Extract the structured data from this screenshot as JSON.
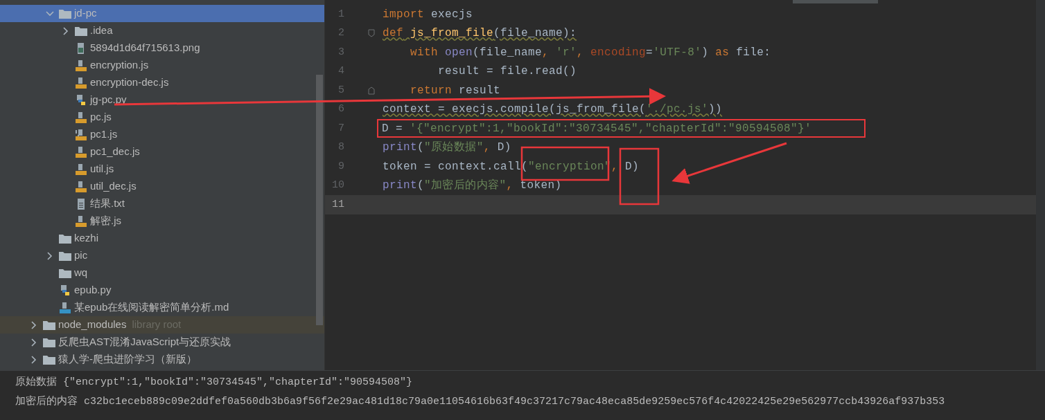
{
  "project_tree": [
    {
      "children": [
        {
          "name": "jd-pc",
          "kind": "folder",
          "expanded": true,
          "selected": true,
          "children": [
            {
              "name": ".idea",
              "kind": "folder",
              "expanded": false,
              "selected": false
            },
            {
              "name": "5894d1d64f715613.png",
              "kind": "image",
              "selected": false
            },
            {
              "name": "encryption.js",
              "kind": "js",
              "selected": false
            },
            {
              "name": "encryption-dec.js",
              "kind": "js",
              "selected": false
            },
            {
              "name": "jg-pc.py",
              "kind": "python",
              "selected": false
            },
            {
              "name": "pc.js",
              "kind": "js",
              "selected": false
            },
            {
              "name": "pc1.js",
              "kind": "js-binary",
              "selected": false
            },
            {
              "name": "pc1_dec.js",
              "kind": "js",
              "selected": false
            },
            {
              "name": "util.js",
              "kind": "js",
              "selected": false
            },
            {
              "name": "util_dec.js",
              "kind": "js",
              "selected": false
            },
            {
              "name": "结果.txt",
              "kind": "text",
              "selected": false
            },
            {
              "name": "解密.js",
              "kind": "js",
              "selected": false
            }
          ]
        },
        {
          "name": "kezhi",
          "kind": "folder",
          "selected": false
        },
        {
          "name": "pic",
          "kind": "folder",
          "expanded": false,
          "selected": false
        },
        {
          "name": "wq",
          "kind": "folder",
          "selected": false
        },
        {
          "name": "epub.py",
          "kind": "python",
          "selected": false
        },
        {
          "name": "某epub在线阅读解密简单分析.md",
          "kind": "markdown",
          "selected": false
        }
      ]
    },
    {
      "name": "node_modules",
      "kind": "library",
      "hint": "library root",
      "expanded": false,
      "selected": false
    },
    {
      "name": "反爬虫AST混淆JavaScript与还原实战",
      "kind": "folder",
      "expanded": false,
      "selected": false
    },
    {
      "name": "猿人学-爬虫进阶学习（新版）",
      "kind": "folder",
      "expanded": false,
      "selected": false
    }
  ],
  "editor": {
    "lines": [
      {
        "number": "1",
        "tokens": [
          {
            "kind": "keyword",
            "text": "import"
          },
          {
            "kind": "plain",
            "text": " execjs"
          }
        ]
      },
      {
        "number": "2",
        "fold_start": true,
        "warning": true,
        "tokens": [
          {
            "kind": "keyword",
            "text": "def"
          },
          {
            "kind": "function",
            "text": " js_from_file"
          },
          {
            "kind": "plain",
            "text": "(file_name):"
          }
        ]
      },
      {
        "number": "3",
        "tokens": [
          {
            "kind": "keyword",
            "text": "    with"
          },
          {
            "kind": "builtin",
            "text": " open"
          },
          {
            "kind": "plain",
            "text": "(file_name"
          },
          {
            "kind": "keyword",
            "text": ", "
          },
          {
            "kind": "string",
            "text": "'r'"
          },
          {
            "kind": "keyword",
            "text": ", "
          },
          {
            "kind": "param",
            "text": "encoding"
          },
          {
            "kind": "plain",
            "text": "="
          },
          {
            "kind": "string",
            "text": "'UTF-8'"
          },
          {
            "kind": "plain",
            "text": ") "
          },
          {
            "kind": "keyword",
            "text": "as"
          },
          {
            "kind": "plain",
            "text": " file:"
          }
        ]
      },
      {
        "number": "4",
        "tokens": [
          {
            "kind": "plain",
            "text": "        result = file.read()"
          }
        ]
      },
      {
        "number": "5",
        "fold_end": true,
        "tokens": [
          {
            "kind": "keyword",
            "text": "    return"
          },
          {
            "kind": "plain",
            "text": " result"
          }
        ]
      },
      {
        "number": "6",
        "warning": true,
        "tokens": [
          {
            "kind": "plain",
            "text": "context = execjs.compile(js_from_file("
          },
          {
            "kind": "string",
            "text": "'./pc.js'"
          },
          {
            "kind": "plain",
            "text": "))"
          }
        ]
      },
      {
        "number": "7",
        "framed": true,
        "tokens": [
          {
            "kind": "plain",
            "text": "D = "
          },
          {
            "kind": "string",
            "text": "'{\"encrypt\":1,\"bookId\":\"30734545\",\"chapterId\":\"90594508\"}'"
          }
        ]
      },
      {
        "number": "8",
        "tokens": [
          {
            "kind": "builtin",
            "text": "print"
          },
          {
            "kind": "plain",
            "text": "("
          },
          {
            "kind": "string",
            "text": "\"原始数据\""
          },
          {
            "kind": "keyword",
            "text": ", "
          },
          {
            "kind": "plain",
            "text": "D)"
          }
        ]
      },
      {
        "number": "9",
        "tokens": [
          {
            "kind": "plain",
            "text": "token = context.call("
          },
          {
            "kind": "string",
            "text": "\"encryption\""
          },
          {
            "kind": "keyword",
            "text": ", "
          },
          {
            "kind": "plain",
            "text": "D)"
          }
        ]
      },
      {
        "number": "10",
        "tokens": [
          {
            "kind": "builtin",
            "text": "print"
          },
          {
            "kind": "plain",
            "text": "("
          },
          {
            "kind": "string",
            "text": "\"加密后的内容\""
          },
          {
            "kind": "keyword",
            "text": ", "
          },
          {
            "kind": "plain",
            "text": "token)"
          }
        ]
      },
      {
        "number": "11",
        "current": true
      }
    ]
  },
  "run_output": {
    "lines": [
      "原始数据 {\"encrypt\":1,\"bookId\":\"30734545\",\"chapterId\":\"90594508\"}",
      "加密后的内容 c32bc1eceb889c09e2ddfef0a560db3b6a9f56f2e29ac481d18c79a0e11054616b63f49c37217c79ac48eca85de9259ec576f4c42022425e29e562977ccb43926af937b353"
    ]
  }
}
